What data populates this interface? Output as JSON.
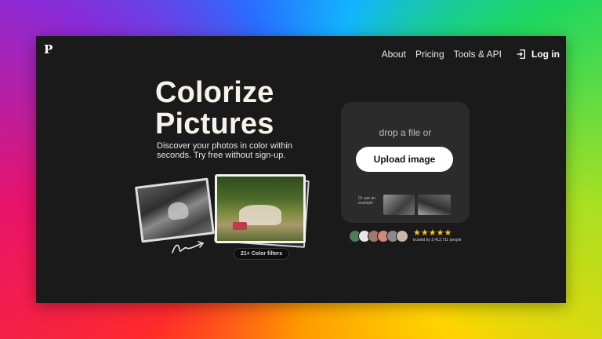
{
  "brand": {
    "logo": "P"
  },
  "nav": {
    "about": "About",
    "pricing": "Pricing",
    "tools": "Tools & API",
    "login": "Log in"
  },
  "hero": {
    "title_line1": "Colorize",
    "title_line2": "Pictures",
    "subtitle": "Discover your photos in color within seconds. Try free without sign-up."
  },
  "filters_chip": "21+ Color filters",
  "upload": {
    "drop_text": "drop a file or",
    "button_label": "Upload image",
    "example_label": "Or use an example"
  },
  "trust": {
    "stars": "★★★★★",
    "text": "trusted by 2,412,711 people",
    "avatar_colors": [
      "#4d7a5a",
      "#e8e8e8",
      "#a07a6a",
      "#d18a7a",
      "#8a8a8a",
      "#c9b8a8"
    ]
  },
  "colors": {
    "window_bg": "#1a1a1a",
    "card_bg": "#2b2b2b",
    "star": "#f5c518"
  }
}
